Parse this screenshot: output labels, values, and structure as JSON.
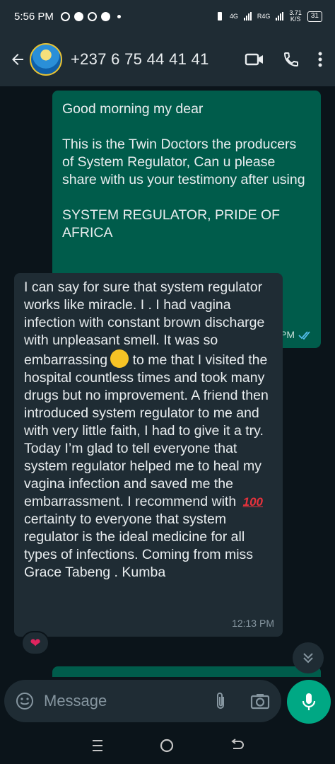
{
  "status_bar": {
    "time": "5:56 PM",
    "network_1": "4G",
    "network_2": "R4G",
    "speed_value": "3.71",
    "speed_unit": "K/S",
    "battery": "31"
  },
  "header": {
    "contact_name": "+237 6 75 44 41 41",
    "icons": [
      "back-arrow-icon",
      "video-call-icon",
      "phone-icon",
      "more-icon"
    ]
  },
  "messages": [
    {
      "direction": "outgoing",
      "paragraphs": [
        "Good morning my dear",
        "This is the Twin Doctors the producers of System Regulator, Can u please share with us your testimony after using",
        "SYSTEM REGULATOR, PRIDE OF AFRICA"
      ],
      "time": "12:10 PM",
      "status": "read"
    },
    {
      "direction": "incoming",
      "text_part1": "I can say for sure that system regulator works like miracle. I . I had vagina infection with constant brown discharge with  unpleasant smell. It was so embarrassing",
      "text_part2": "to me that I visited the hospital countless times and took many drugs but no improvement. A friend then introduced system regulator to me and with very little faith, I had to give it a try. Today I’m glad to tell everyone that system regulator helped me to heal my vagina infection and saved me the embarrassment. I recommend with",
      "emoji_hundred": "100",
      "text_part3": "certainty to everyone that system regulator is the ideal medicine for all types of infections. Coming from miss Grace Tabeng . Kumba",
      "time": "12:13 PM",
      "reaction": "❤"
    }
  ],
  "composer": {
    "placeholder": "Message"
  },
  "colors": {
    "outgoing_bubble": "#005c4b",
    "incoming_bubble": "#1f2c34",
    "accent": "#00a884",
    "background": "#0b141a"
  }
}
